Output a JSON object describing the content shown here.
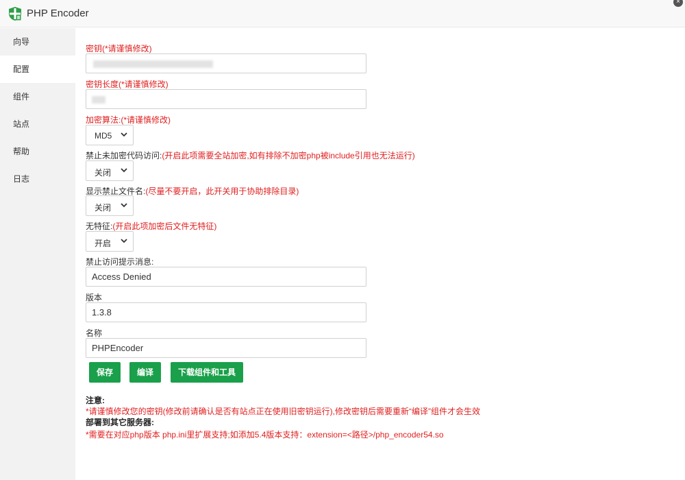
{
  "app": {
    "title": "PHP Encoder",
    "close_glyph": "×"
  },
  "sidebar": {
    "items": [
      {
        "label": "向导",
        "active": false
      },
      {
        "label": "配置",
        "active": true
      },
      {
        "label": "组件",
        "active": false
      },
      {
        "label": "站点",
        "active": false
      },
      {
        "label": "帮助",
        "active": false
      },
      {
        "label": "日志",
        "active": false
      }
    ]
  },
  "form": {
    "key": {
      "label": "密钥(*请谨慎修改)"
    },
    "key_length": {
      "label": "密钥长度(*请谨慎修改)"
    },
    "algorithm": {
      "label": "加密算法:(*请谨慎修改)",
      "value": "MD5"
    },
    "block_unencrypted": {
      "label": "禁止未加密代码访问:",
      "hint": "(开启此项需要全站加密,如有排除不加密php被include引用也无法运行)",
      "value": "关闭"
    },
    "show_blocked_filename": {
      "label": "显示禁止文件名:",
      "hint": "(尽量不要开启，此开关用于协助排除目录)",
      "value": "关闭"
    },
    "no_signature": {
      "label": "无特征:",
      "hint": "(开启此项加密后文件无特征)",
      "value": "开启"
    },
    "deny_message": {
      "label": "禁止访问提示消息:",
      "value": "Access Denied"
    },
    "version": {
      "label": "版本",
      "value": "1.3.8"
    },
    "name": {
      "label": "名称",
      "value": "PHPEncoder"
    }
  },
  "buttons": {
    "save": "保存",
    "compile": "编译",
    "download": "下载组件和工具"
  },
  "notes": {
    "heading": "注意:",
    "line1": "*请谨慎修改您的密钥(修改前请确认是否有站点正在使用旧密钥运行),修改密钥后需要重新“编译”组件才会生效",
    "heading2": "部署到其它服务器:",
    "line2": "*需要在对应php版本 php.ini里扩展支持;如添加5.4版本支持：extension=<路径>/php_encoder54.so"
  },
  "colors": {
    "accent_green": "#1aa04a",
    "warning_red": "#e02020",
    "sidebar_bg": "#f2f2f2"
  },
  "icons": {
    "app": "shield-icon",
    "select": "chevron-down-icon",
    "close": "close-icon"
  }
}
